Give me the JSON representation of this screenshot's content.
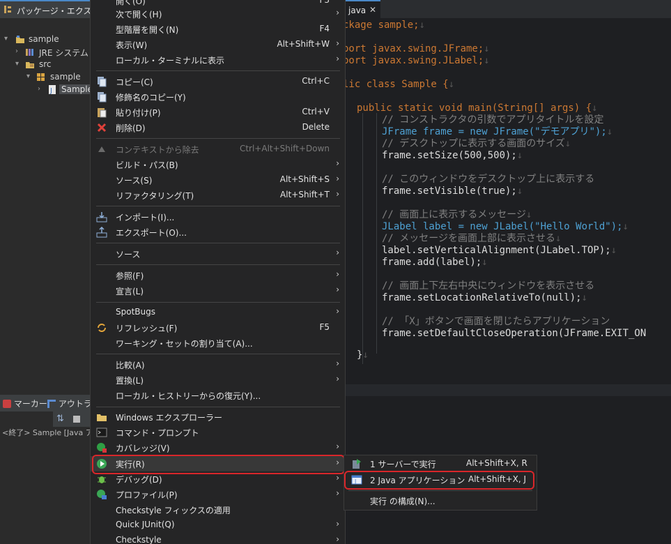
{
  "package_explorer": {
    "tab_label": "パッケージ・エクスプロー",
    "tree": [
      {
        "label": "sample"
      },
      {
        "label": "JRE システム・ラ"
      },
      {
        "label": "src"
      },
      {
        "label": "sample"
      },
      {
        "label": "Sample"
      }
    ]
  },
  "lower_views": {
    "marker_tab": "マーカー",
    "outline_tab": "アウトライ",
    "console_text": "<終了> Sample [Java アプ"
  },
  "editor": {
    "tab_label": "java",
    "close_glyph": "✕"
  },
  "context_menu": {
    "items": [
      {
        "label": "開く(O)",
        "shortcut": "F3"
      },
      {
        "label": "次で開く(H)",
        "submenu": "›"
      },
      {
        "label": "型階層を開く(N)",
        "shortcut": "F4"
      },
      {
        "label": "表示(W)",
        "shortcut": "Alt+Shift+W",
        "submenu": "›"
      },
      {
        "label": "ローカル・ターミナルに表示",
        "submenu": "›"
      },
      {
        "label": "コピー(C)",
        "shortcut": "Ctrl+C"
      },
      {
        "label": "修飾名のコピー(Y)"
      },
      {
        "label": "貼り付け(P)",
        "shortcut": "Ctrl+V"
      },
      {
        "label": "削除(D)",
        "shortcut": "Delete"
      },
      {
        "label": "コンテキストから除去",
        "shortcut": "Ctrl+Alt+Shift+Down"
      },
      {
        "label": "ビルド・パス(B)",
        "submenu": "›"
      },
      {
        "label": "ソース(S)",
        "shortcut": "Alt+Shift+S",
        "submenu": "›"
      },
      {
        "label": "リファクタリング(T)",
        "shortcut": "Alt+Shift+T",
        "submenu": "›"
      },
      {
        "label": "インポート(I)..."
      },
      {
        "label": "エクスポート(O)..."
      },
      {
        "label": "ソース",
        "submenu": "›"
      },
      {
        "label": "参照(F)",
        "submenu": "›"
      },
      {
        "label": "宣言(L)",
        "submenu": "›"
      },
      {
        "label": "SpotBugs",
        "submenu": "›"
      },
      {
        "label": "リフレッシュ(F)",
        "shortcut": "F5"
      },
      {
        "label": "ワーキング・セットの割り当て(A)..."
      },
      {
        "label": "比較(A)",
        "submenu": "›"
      },
      {
        "label": "置換(L)",
        "submenu": "›"
      },
      {
        "label": "ローカル・ヒストリーからの復元(Y)..."
      },
      {
        "label": "Windows エクスプローラー"
      },
      {
        "label": "コマンド・プロンプト"
      },
      {
        "label": "カバレッジ(V)",
        "submenu": "›"
      },
      {
        "label": "実行(R)",
        "submenu": "›"
      },
      {
        "label": "デバッグ(D)",
        "submenu": "›"
      },
      {
        "label": "プロファイル(P)",
        "submenu": "›"
      },
      {
        "label": "Checkstyle フィックスの適用"
      },
      {
        "label": "Quick JUnit(Q)",
        "submenu": "›"
      },
      {
        "label": "Checkstyle",
        "submenu": "›"
      }
    ]
  },
  "run_submenu": {
    "items": [
      {
        "label": "1 サーバーで実行",
        "shortcut": "Alt+Shift+X, R"
      },
      {
        "label": "2 Java アプリケーション",
        "shortcut": "Alt+Shift+X, J"
      },
      {
        "label": "実行 の構成(N)..."
      }
    ]
  },
  "code_lines": [
    "ckage sample;",
    "port javax.swing.JFrame;",
    "port javax.swing.JLabel;",
    "lic class Sample {",
    "public static void main(String[] args) {",
    "// コンストラクタの引数でアプリタイトルを設定",
    "JFrame frame = new JFrame(\"デモアプリ\");",
    "// デスクトップに表示する画面のサイズ",
    "frame.setSize(500,500);",
    "// このウィンドウをデスクトップ上に表示する",
    "frame.setVisible(true);",
    "// 画面上に表示するメッセージ",
    "JLabel label = new JLabel(\"Hello World\");",
    "// メッセージを画面上部に表示させる",
    "label.setVerticalAlignment(JLabel.TOP);",
    "frame.add(label);",
    "// 画面上下左右中央にウィンドウを表示させる",
    "frame.setLocationRelativeTo(null);",
    "// 「X」ボタンで画面を閉じたらアプリケーション",
    "frame.setDefaultCloseOperation(JFrame.EXIT_ON",
    "}"
  ]
}
